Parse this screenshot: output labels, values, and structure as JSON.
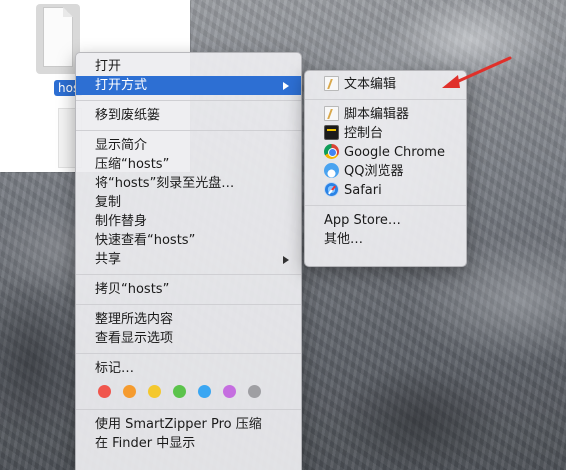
{
  "finder": {
    "file_label": "hos"
  },
  "context_menu": {
    "items": [
      {
        "label": "打开"
      },
      {
        "label": "打开方式"
      },
      {
        "label": "移到废纸篓"
      },
      {
        "label": "显示简介"
      },
      {
        "label": "压缩“hosts”"
      },
      {
        "label": "将“hosts”刻录至光盘…"
      },
      {
        "label": "复制"
      },
      {
        "label": "制作替身"
      },
      {
        "label": "快速查看“hosts”"
      },
      {
        "label": "共享"
      },
      {
        "label": "拷贝“hosts”"
      },
      {
        "label": "整理所选内容"
      },
      {
        "label": "查看显示选项"
      },
      {
        "label": "标记…"
      },
      {
        "label": "使用 SmartZipper Pro 压缩"
      },
      {
        "label": "在 Finder 中显示"
      }
    ],
    "tag_colors": [
      "#f0564d",
      "#f59b2f",
      "#f4c82e",
      "#5bc34b",
      "#3aa6f2",
      "#c56ee0",
      "#9f9fa3"
    ]
  },
  "open_with_submenu": {
    "items": [
      {
        "label": "文本编辑",
        "icon": "textedit-icon"
      },
      {
        "label": "脚本编辑器",
        "icon": "script-editor-icon"
      },
      {
        "label": "控制台",
        "icon": "console-icon"
      },
      {
        "label": "Google Chrome",
        "icon": "chrome-icon"
      },
      {
        "label": "QQ浏览器",
        "icon": "qq-browser-icon"
      },
      {
        "label": "Safari",
        "icon": "safari-icon"
      },
      {
        "label": "App Store…"
      },
      {
        "label": "其他…"
      }
    ]
  },
  "colors": {
    "highlight": "#2d6fd3",
    "annotation_arrow": "#e0302a"
  }
}
